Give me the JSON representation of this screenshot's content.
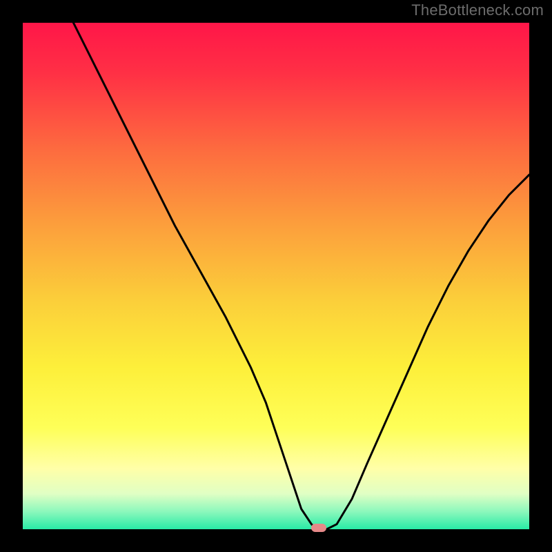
{
  "watermark": "TheBottleneck.com",
  "plot": {
    "inner_left": 33,
    "inner_top": 33,
    "inner_width": 734,
    "inner_height": 734,
    "gradient_stops": [
      {
        "offset": 0.0,
        "color": "#ff1648"
      },
      {
        "offset": 0.1,
        "color": "#ff3045"
      },
      {
        "offset": 0.25,
        "color": "#fd6b3f"
      },
      {
        "offset": 0.4,
        "color": "#fc9f3c"
      },
      {
        "offset": 0.55,
        "color": "#fbcf3a"
      },
      {
        "offset": 0.68,
        "color": "#fdef3a"
      },
      {
        "offset": 0.8,
        "color": "#feff58"
      },
      {
        "offset": 0.88,
        "color": "#ffffa8"
      },
      {
        "offset": 0.93,
        "color": "#e0ffc4"
      },
      {
        "offset": 0.965,
        "color": "#8cf8bc"
      },
      {
        "offset": 1.0,
        "color": "#28eba6"
      }
    ]
  },
  "chart_data": {
    "type": "line",
    "title": "",
    "xlabel": "",
    "ylabel": "",
    "xlim": [
      0,
      100
    ],
    "ylim": [
      0,
      100
    ],
    "grid": false,
    "legend": false,
    "series": [
      {
        "name": "bottleneck-curve",
        "x": [
          10,
          15,
          20,
          25,
          30,
          35,
          40,
          45,
          48,
          50,
          52,
          54,
          55,
          57,
          58,
          60,
          62,
          65,
          68,
          72,
          76,
          80,
          84,
          88,
          92,
          96,
          100
        ],
        "y": [
          100,
          90,
          80,
          70,
          60,
          51,
          42,
          32,
          25,
          19,
          13,
          7,
          4,
          1,
          0,
          0,
          1,
          6,
          13,
          22,
          31,
          40,
          48,
          55,
          61,
          66,
          70
        ]
      }
    ],
    "marker": {
      "x": 58.5,
      "y": 0,
      "color": "#e68989"
    }
  }
}
